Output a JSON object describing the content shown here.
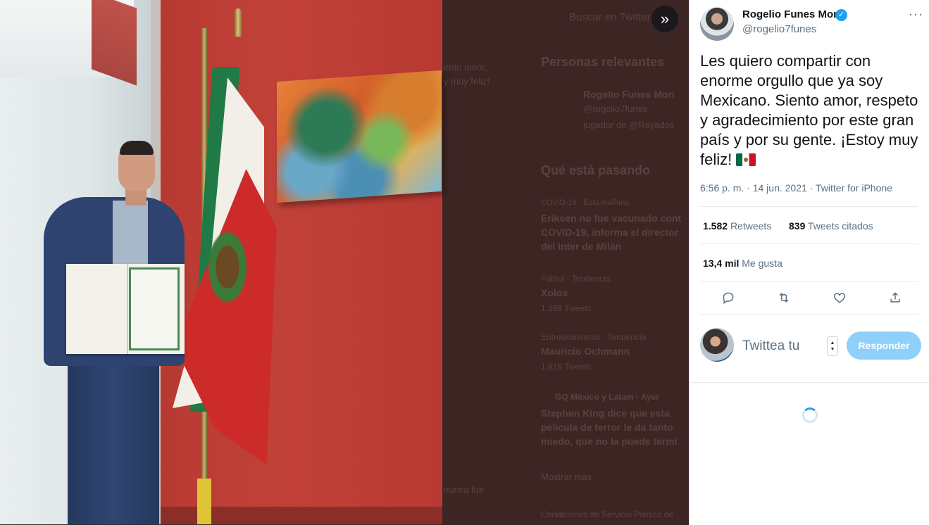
{
  "tweet": {
    "author_name": "Rogelio Funes Mori",
    "author_handle": "@rogelio7funes",
    "verified_glyph": "✓",
    "more_glyph": "···",
    "text": "Les quiero compartir con enorme orgullo que ya soy Mexicano. Siento amor, respeto y agradecimiento por este gran país y por su gente. ¡Estoy muy feliz!",
    "emoji_name": "mexico-flag-icon",
    "time": "6:56 p. m.",
    "date": "14 jun. 2021",
    "source": "Twitter for iPhone",
    "separator": "·"
  },
  "stats": {
    "retweets_count": "1.582",
    "retweets_label": "Retweets",
    "quotes_count": "839",
    "quotes_label": "Tweets citados",
    "likes_count": "13,4 mil",
    "likes_label": "Me gusta"
  },
  "actions": [
    "reply-icon",
    "retweet-icon",
    "like-icon",
    "share-icon"
  ],
  "reply_box": {
    "placeholder": "Twittea tu",
    "button_label": "Responder",
    "button_color": "#8ed0f9"
  },
  "expand_glyph": "»",
  "background_ghost": {
    "search": "Buscar en Twitter",
    "relevant_header": "Personas relevantes",
    "relevant_name": "Rogelio Funes Mori",
    "relevant_handle": "@rogelio7funes",
    "relevant_bio": "jugador de @Rayados",
    "tweet_frag1": "ento amor,",
    "tweet_frag2": "y muy feliz!",
    "trending_header": "Qué está pasando",
    "trend1_meta": "COVID-19 · Esta mañana",
    "trend1_title": "Eriksen no fue vacunado cont",
    "trend1_title2": "COVID-19, informa el director",
    "trend1_title3": "del Inter de Milán",
    "trend2_meta": "Fútbol · Tendencia",
    "trend2_title": "Xolos",
    "trend2_count": "1.299 Tweets",
    "trend3_meta": "Entretenimiento · Tendencia",
    "trend3_title": "Mauricio Ochmann",
    "trend3_count": "1.818 Tweets",
    "trend4_meta": "GQ México y Latam · Ayer",
    "trend4_title": "Stephen King dice que esta",
    "trend4_title2": "película de terror le da tanto",
    "trend4_title3": "miedo, que no la puede termi",
    "show_more": "Mostrar más",
    "frag_nunca": "nunca fue",
    "footer": "Condiciones de Servicio   Política de"
  },
  "colors": {
    "accent": "#1da1f2",
    "text_primary": "#0f1419",
    "text_secondary": "#5b7083"
  }
}
